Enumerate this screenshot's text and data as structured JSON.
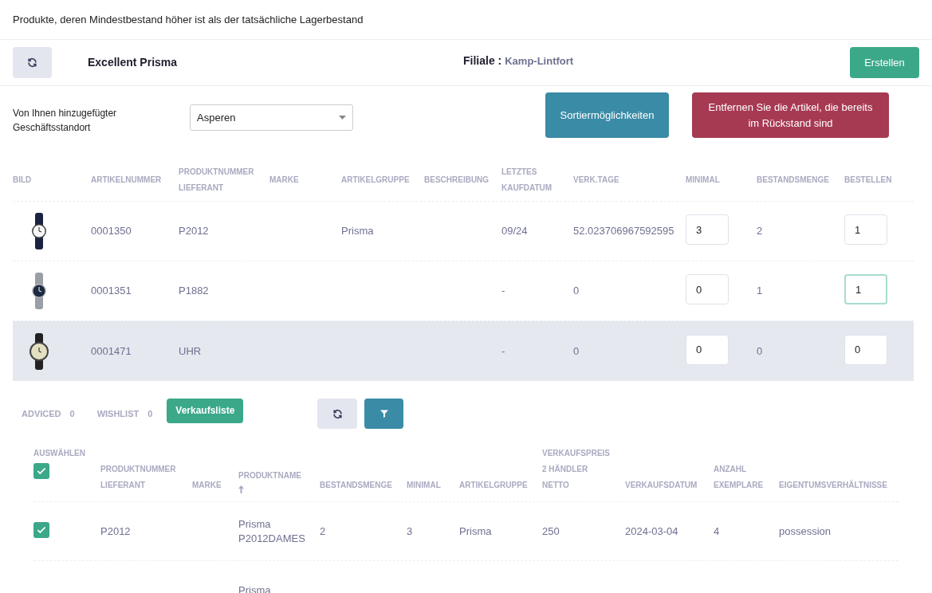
{
  "page_title": "Produkte, deren Mindestbestand höher ist als der tatsächliche Lagerbestand",
  "header": {
    "company": "Excellent Prisma",
    "branch_label": "Filiale :",
    "branch": "Kamp-Lintfort",
    "create_button": "Erstellen"
  },
  "filter": {
    "label": "Von Ihnen hinzugefügter Geschäftsstandort",
    "select_value": "Asperen",
    "sort_button": "Sortiermöglichkeiten",
    "remove_button": "Entfernen Sie die Artikel, die bereits im Rückstand sind"
  },
  "stock_table": {
    "columns": [
      {
        "lines": [
          "BILD"
        ]
      },
      {
        "lines": [
          "ARTIKELNUMMER"
        ]
      },
      {
        "lines": [
          "PRODUKTNUMMER",
          "LIEFERANT"
        ]
      },
      {
        "lines": [
          "MARKE"
        ]
      },
      {
        "lines": [
          "ARTIKELGRUPPE"
        ]
      },
      {
        "lines": [
          "BESCHREIBUNG"
        ]
      },
      {
        "lines": [
          "LETZTES",
          "KAUFDATUM"
        ]
      },
      {
        "lines": [
          "VERK.TAGE"
        ]
      },
      {
        "lines": [
          "MINIMAL"
        ]
      },
      {
        "lines": [
          "BESTANDSMENGE"
        ]
      },
      {
        "lines": [
          "BESTELLEN"
        ]
      }
    ],
    "rows": [
      {
        "artikelnummer": "0001350",
        "produktnummer": "P2012",
        "artikelgruppe": "Prisma",
        "kaufdatum": "09/24",
        "verk_tage": "52.023706967592595",
        "minimal": "3",
        "bestand": "2",
        "bestellen": "1",
        "bestellen_focused": false,
        "highlighted": false
      },
      {
        "artikelnummer": "0001351",
        "produktnummer": "P1882",
        "kaufdatum": "-",
        "verk_tage": "0",
        "minimal": "0",
        "bestand": "1",
        "bestellen": "1",
        "bestellen_focused": true,
        "highlighted": false
      },
      {
        "artikelnummer": "0001471",
        "produktnummer": "UHR",
        "kaufdatum": "-",
        "verk_tage": "0",
        "minimal": "0",
        "bestand": "0",
        "bestellen": "0",
        "bestellen_focused": false,
        "highlighted": true
      }
    ]
  },
  "counters": [
    {
      "label": "ADVICED",
      "value": "0"
    },
    {
      "label": "WISHLIST",
      "value": "0"
    }
  ],
  "sales_list_button": "Verkaufsliste",
  "sales_table": {
    "select_label": "AUSWÄHLEN",
    "select_all_checked": true,
    "columns": [
      {
        "lines": [
          "PRODUKTNUMMER",
          "LIEFERANT"
        ],
        "sorted": false
      },
      {
        "lines": [
          "MARKE"
        ],
        "sorted": false
      },
      {
        "lines": [
          "PRODUKTNAME"
        ],
        "sorted": true
      },
      {
        "lines": [
          "BESTANDSMENGE"
        ],
        "sorted": false
      },
      {
        "lines": [
          "MINIMAL"
        ],
        "sorted": false
      },
      {
        "lines": [
          "ARTIKELGRUPPE"
        ],
        "sorted": false
      },
      {
        "lines": [
          "VERKAUFSPREIS",
          "2 HÄNDLER",
          "NETTO"
        ],
        "sorted": false
      },
      {
        "lines": [
          "VERKAUFSDATUM"
        ],
        "sorted": false
      },
      {
        "lines": [
          "ANZAHL",
          "EXEMPLARE"
        ],
        "sorted": false
      },
      {
        "lines": [
          "EIGENTUMSVERHÄLTNISSE"
        ],
        "sorted": false
      }
    ],
    "rows": [
      {
        "checked": true,
        "cells": [
          "P2012",
          "",
          "Prisma P2012DAMES",
          "2",
          "3",
          "Prisma",
          "250",
          "2024-03-04",
          "4",
          "possession"
        ]
      },
      {
        "cells": [
          "",
          "",
          "Prisma",
          "",
          "",
          "",
          "",
          "",
          "",
          ""
        ]
      }
    ]
  }
}
